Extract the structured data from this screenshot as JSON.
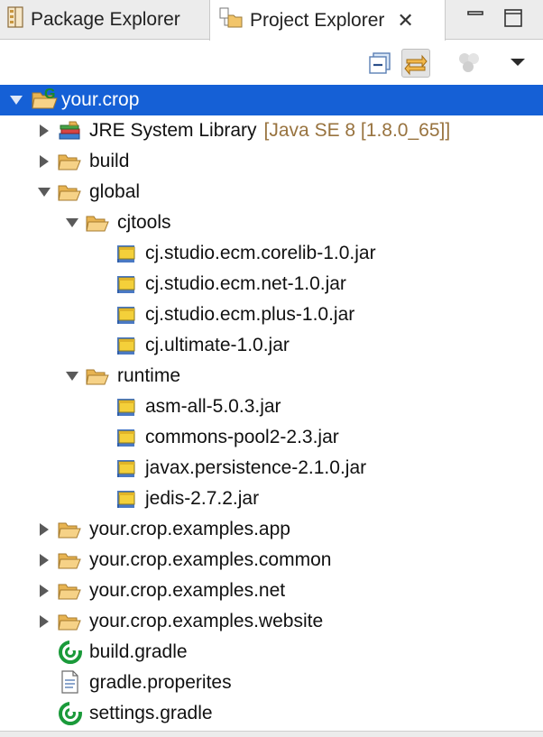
{
  "tabs": [
    {
      "label": "Package Explorer",
      "icon": "package-explorer-icon",
      "active": false
    },
    {
      "label": "Project Explorer",
      "icon": "project-explorer-icon",
      "active": true
    }
  ],
  "tab_close_glyph": "✕",
  "window_controls": [
    "minimize-icon",
    "maximize-icon"
  ],
  "toolbar": [
    "collapse-all-icon",
    "link-with-editor-icon",
    "focus-icon",
    "view-menu-icon"
  ],
  "colors": {
    "selection": "#1560d6",
    "decoration": "#98733f",
    "folder": "#f2c56a",
    "jar": "#f4d03a",
    "gradle": "#1a9a3a"
  },
  "tree": [
    {
      "label": "your.crop",
      "depth": 0,
      "expanded": true,
      "selected": true,
      "icon": "gradle-project-icon",
      "type": "project"
    },
    {
      "label": "JRE System Library",
      "decoration": "[Java SE 8 [1.8.0_65]]",
      "depth": 1,
      "expanded": false,
      "icon": "library-icon",
      "type": "library"
    },
    {
      "label": "build",
      "depth": 1,
      "expanded": false,
      "icon": "folder-icon",
      "type": "folder"
    },
    {
      "label": "global",
      "depth": 1,
      "expanded": true,
      "icon": "folder-icon",
      "type": "folder"
    },
    {
      "label": "cjtools",
      "depth": 2,
      "expanded": true,
      "icon": "folder-icon",
      "type": "folder"
    },
    {
      "label": "cj.studio.ecm.corelib-1.0.jar",
      "depth": 3,
      "icon": "jar-icon",
      "type": "jar"
    },
    {
      "label": "cj.studio.ecm.net-1.0.jar",
      "depth": 3,
      "icon": "jar-icon",
      "type": "jar"
    },
    {
      "label": "cj.studio.ecm.plus-1.0.jar",
      "depth": 3,
      "icon": "jar-icon",
      "type": "jar"
    },
    {
      "label": "cj.ultimate-1.0.jar",
      "depth": 3,
      "icon": "jar-icon",
      "type": "jar"
    },
    {
      "label": "runtime",
      "depth": 2,
      "expanded": true,
      "icon": "folder-icon",
      "type": "folder"
    },
    {
      "label": "asm-all-5.0.3.jar",
      "depth": 3,
      "icon": "jar-icon",
      "type": "jar"
    },
    {
      "label": "commons-pool2-2.3.jar",
      "depth": 3,
      "icon": "jar-icon",
      "type": "jar"
    },
    {
      "label": "javax.persistence-2.1.0.jar",
      "depth": 3,
      "icon": "jar-icon",
      "type": "jar"
    },
    {
      "label": "jedis-2.7.2.jar",
      "depth": 3,
      "icon": "jar-icon",
      "type": "jar"
    },
    {
      "label": "your.crop.examples.app",
      "depth": 1,
      "expanded": false,
      "icon": "folder-icon",
      "type": "folder"
    },
    {
      "label": "your.crop.examples.common",
      "depth": 1,
      "expanded": false,
      "icon": "folder-icon",
      "type": "folder"
    },
    {
      "label": "your.crop.examples.net",
      "depth": 1,
      "expanded": false,
      "icon": "folder-icon",
      "type": "folder"
    },
    {
      "label": "your.crop.examples.website",
      "depth": 1,
      "expanded": false,
      "icon": "folder-icon",
      "type": "folder"
    },
    {
      "label": "build.gradle",
      "depth": 1,
      "icon": "gradle-file-icon",
      "type": "gradle"
    },
    {
      "label": "gradle.properites",
      "depth": 1,
      "icon": "text-file-icon",
      "type": "text"
    },
    {
      "label": "settings.gradle",
      "depth": 1,
      "icon": "gradle-file-icon",
      "type": "gradle"
    }
  ]
}
